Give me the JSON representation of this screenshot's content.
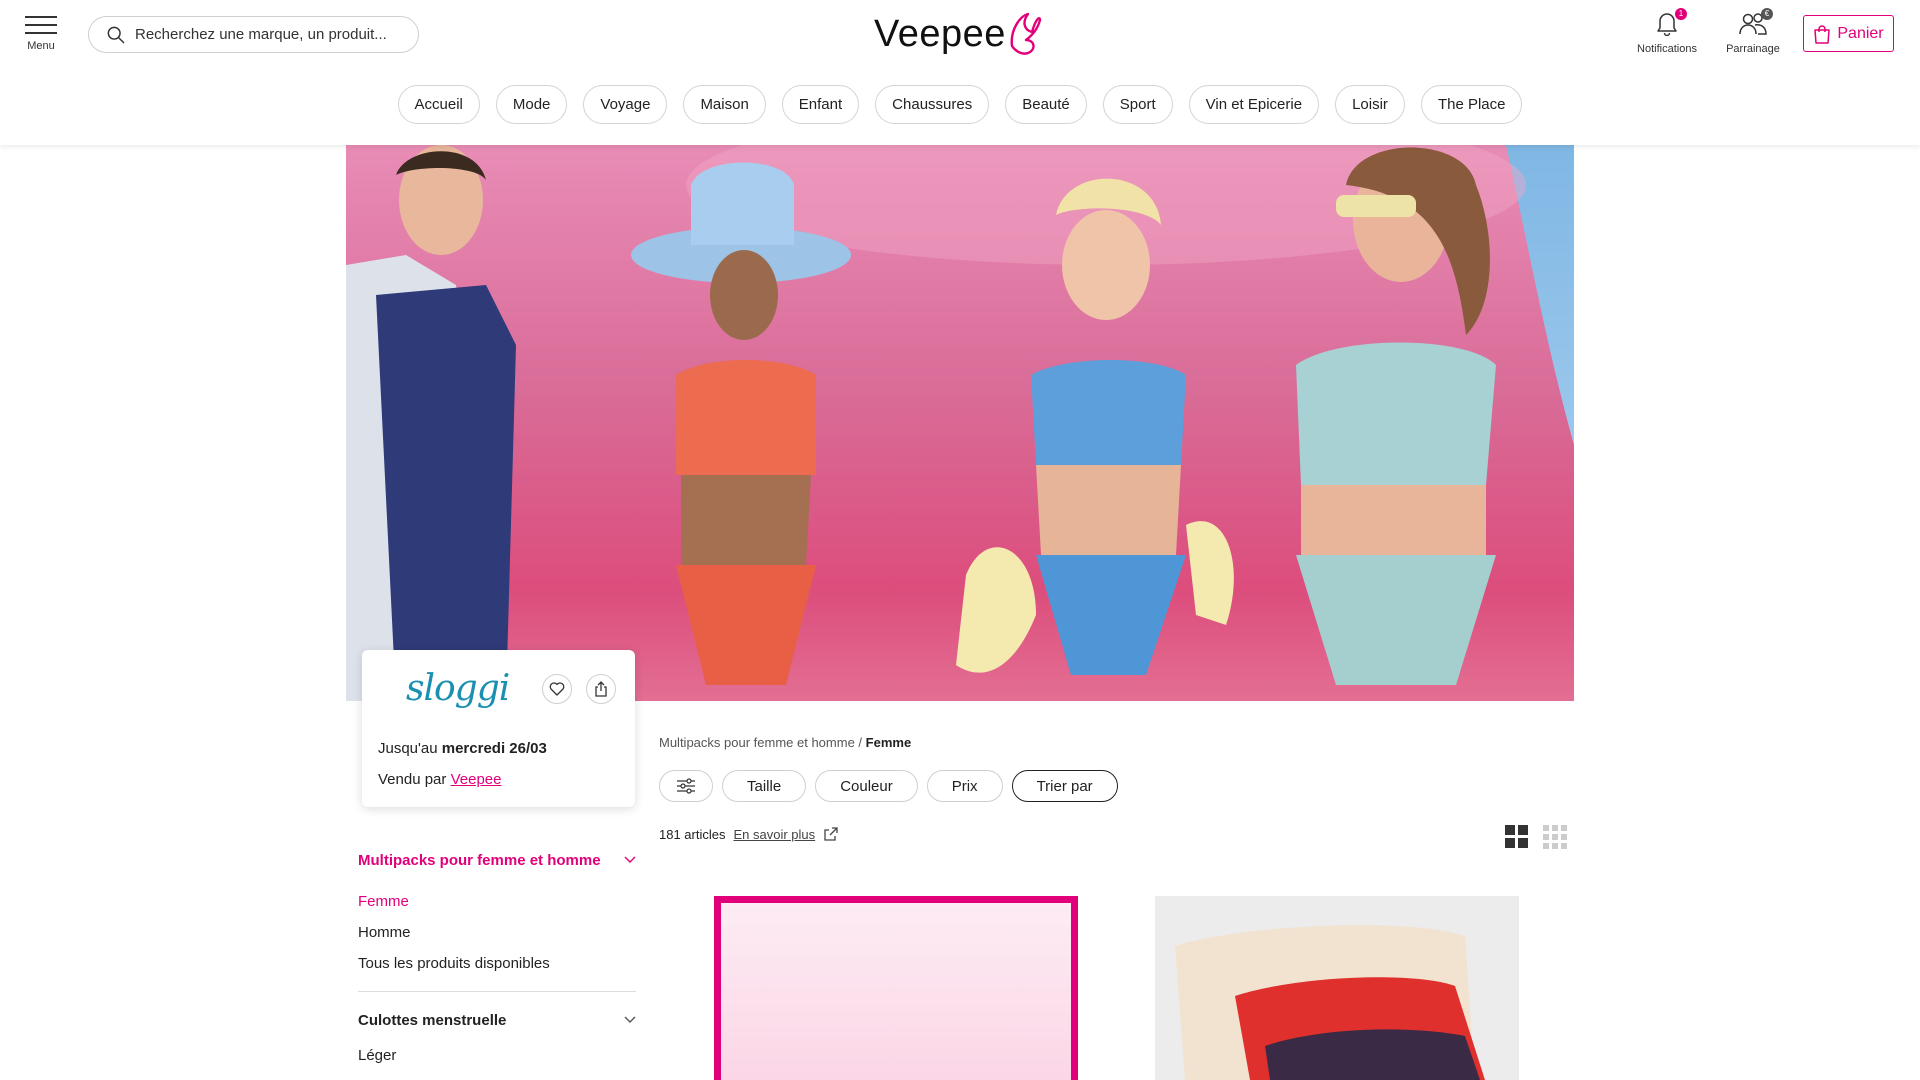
{
  "header": {
    "menu_label": "Menu",
    "search_placeholder": "Recherchez une marque, un produit...",
    "logo_text": "Veepee",
    "notifications_label": "Notifications",
    "notifications_badge": "1",
    "referral_label": "Parrainage",
    "referral_badge": "€",
    "cart_label": "Panier",
    "accent_color": "#e2007a"
  },
  "nav": {
    "items": [
      "Accueil",
      "Mode",
      "Voyage",
      "Maison",
      "Enfant",
      "Chaussures",
      "Beauté",
      "Sport",
      "Vin et Epicerie",
      "Loisir",
      "The Place"
    ]
  },
  "brand": {
    "logo_text": "sloggi",
    "until_prefix": "Jusqu'au",
    "until_date": "mercredi 26/03",
    "sold_prefix": "Vendu par",
    "sold_by": "Veepee"
  },
  "sidebar": {
    "category1": {
      "title": "Multipacks pour femme et homme",
      "items": [
        "Femme",
        "Homme",
        "Tous les produits disponibles"
      ]
    },
    "category2": {
      "title": "Culottes menstruelle",
      "items": [
        "Léger"
      ]
    }
  },
  "listing": {
    "breadcrumb_parent": "Multipacks pour femme et homme",
    "breadcrumb_sep": "/",
    "breadcrumb_current": "Femme",
    "filters": [
      "Taille",
      "Couleur",
      "Prix",
      "Trier par"
    ],
    "count": "181 articles",
    "learn_more": "En savoir plus"
  }
}
